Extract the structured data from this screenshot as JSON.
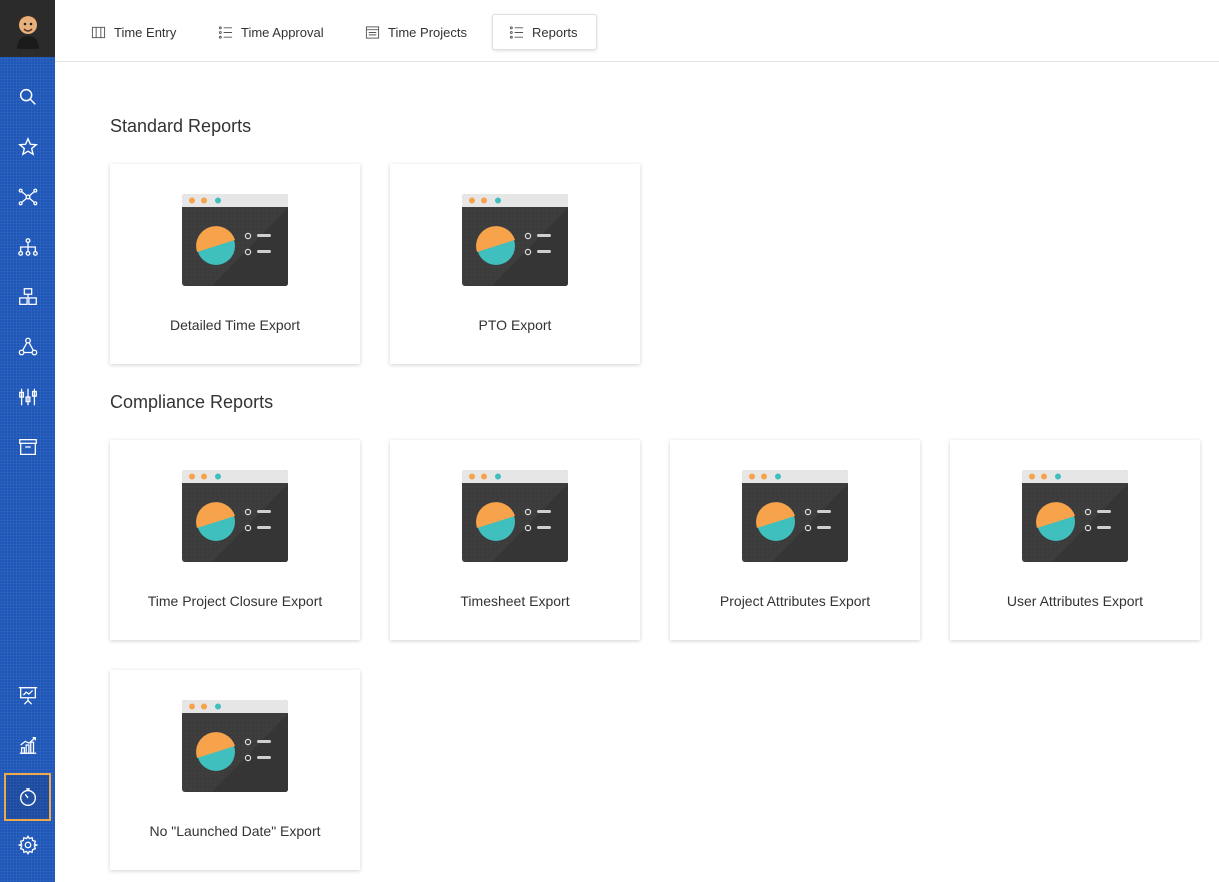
{
  "tabs": [
    {
      "label": "Time Entry",
      "icon": "columns-icon"
    },
    {
      "label": "Time Approval",
      "icon": "list-icon"
    },
    {
      "label": "Time Projects",
      "icon": "document-list-icon"
    },
    {
      "label": "Reports",
      "icon": "list-icon",
      "active": true
    }
  ],
  "sections": [
    {
      "title": "Standard Reports",
      "cards": [
        "Detailed Time Export",
        "PTO Export"
      ]
    },
    {
      "title": "Compliance Reports",
      "cards": [
        "Time Project Closure Export",
        "Timesheet Export",
        "Project Attributes Export",
        "User Attributes Export",
        "No \"Launched Date\" Export"
      ]
    }
  ],
  "sidebar": {
    "items": [
      "search-icon",
      "star-icon",
      "network-icon",
      "hierarchy-icon",
      "blocks-icon",
      "graph-icon",
      "sliders-icon",
      "archive-icon",
      "presentation-icon",
      "chart-icon",
      "stopwatch-icon",
      "gear-icon"
    ],
    "active": "stopwatch-icon"
  },
  "colors": {
    "sidebar": "#1f57b8",
    "active_border": "#f0a94a",
    "pie_orange": "#f6a34c",
    "pie_teal": "#3fbfbd"
  }
}
